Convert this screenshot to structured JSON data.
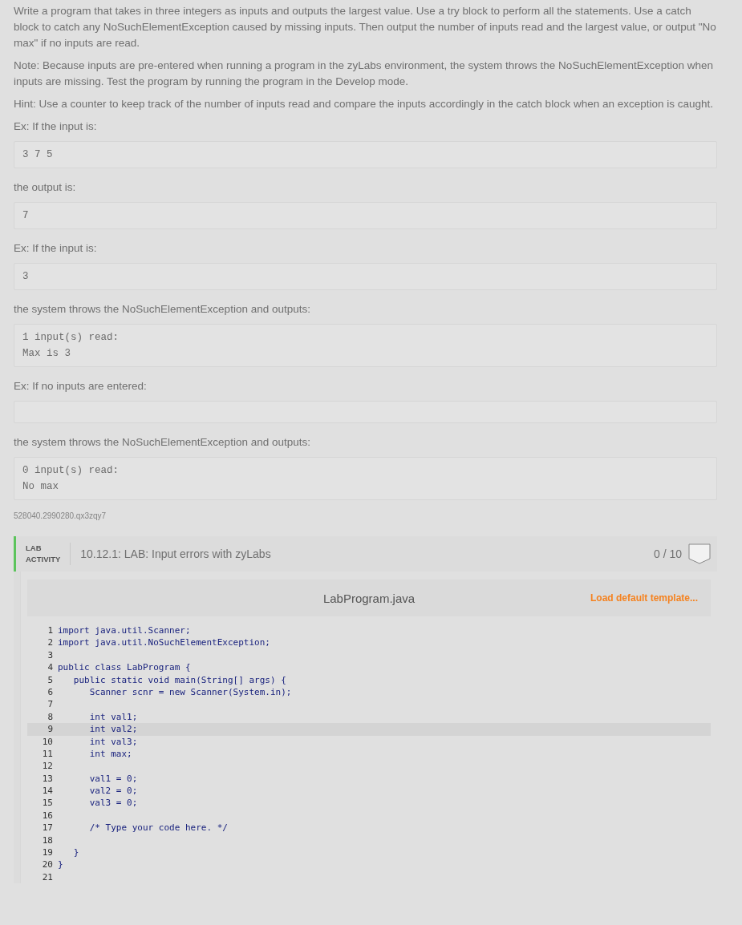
{
  "instructions": [
    {
      "kind": "paragraph",
      "text": "Write a program that takes in three integers as inputs and outputs the largest value. Use a try block to perform all the statements. Use a catch block to catch any NoSuchElementException caused by missing inputs. Then output the number of inputs read and the largest value, or output \"No max\" if no inputs are read."
    },
    {
      "kind": "paragraph",
      "text": "Note: Because inputs are pre-entered when running a program in the zyLabs environment, the system throws the NoSuchElementException when inputs are missing. Test the program by running the program in the Develop mode."
    },
    {
      "kind": "paragraph",
      "text": "Hint: Use a counter to keep track of the number of inputs read and compare the inputs accordingly in the catch block when an exception is caught."
    },
    {
      "kind": "paragraph",
      "text": "Ex: If the input is:"
    },
    {
      "kind": "sample",
      "lines": [
        "3 7 5"
      ]
    },
    {
      "kind": "paragraph",
      "text": "the output is:"
    },
    {
      "kind": "sample",
      "lines": [
        "7"
      ]
    },
    {
      "kind": "paragraph",
      "text": "Ex: If the input is:"
    },
    {
      "kind": "sample",
      "lines": [
        "3"
      ]
    },
    {
      "kind": "paragraph",
      "text": "the system throws the NoSuchElementException and outputs:"
    },
    {
      "kind": "sample",
      "lines": [
        "1 input(s) read:",
        "Max is 3"
      ]
    },
    {
      "kind": "paragraph",
      "text": "Ex: If no inputs are entered:"
    },
    {
      "kind": "sample"
    },
    {
      "kind": "paragraph",
      "text": "the system throws the NoSuchElementException and outputs:"
    },
    {
      "kind": "sample",
      "lines": [
        "0 input(s) read:",
        "No max"
      ]
    },
    {
      "kind": "id",
      "text": "528040.2990280.qx3zqy7"
    }
  ],
  "lab": {
    "label_top": "LAB",
    "label_bottom": "ACTIVITY",
    "title": "10.12.1: LAB: Input errors with zyLabs",
    "score": "0 / 10",
    "complete": false
  },
  "editor": {
    "filename": "LabProgram.java",
    "template_link": "Load default template...",
    "lines": [
      {
        "number": "1",
        "text": "import java.util.Scanner;",
        "active": false
      },
      {
        "number": "2",
        "text": "import java.util.NoSuchElementException;",
        "active": false
      },
      {
        "number": "3",
        "active": false
      },
      {
        "number": "4",
        "text": "public class LabProgram {",
        "active": false
      },
      {
        "number": "5",
        "text": "   public static void main(String[] args) {",
        "active": false
      },
      {
        "number": "6",
        "text": "      Scanner scnr = new Scanner(System.in);",
        "active": false
      },
      {
        "number": "7",
        "active": false
      },
      {
        "number": "8",
        "text": "      int val1;",
        "active": false
      },
      {
        "number": "9",
        "text": "      int val2;",
        "active": true
      },
      {
        "number": "10",
        "text": "      int val3;",
        "active": false
      },
      {
        "number": "11",
        "text": "      int max;",
        "active": false
      },
      {
        "number": "12",
        "active": false
      },
      {
        "number": "13",
        "text": "      val1 = 0;",
        "active": false
      },
      {
        "number": "14",
        "text": "      val2 = 0;",
        "active": false
      },
      {
        "number": "15",
        "text": "      val3 = 0;",
        "active": false
      },
      {
        "number": "16",
        "active": false
      },
      {
        "number": "17",
        "text": "      /* Type your code here. */",
        "active": false
      },
      {
        "number": "18",
        "active": false
      },
      {
        "number": "19",
        "text": "   }",
        "active": false
      },
      {
        "number": "20",
        "text": "}",
        "active": false
      },
      {
        "number": "21",
        "active": false
      }
    ]
  }
}
